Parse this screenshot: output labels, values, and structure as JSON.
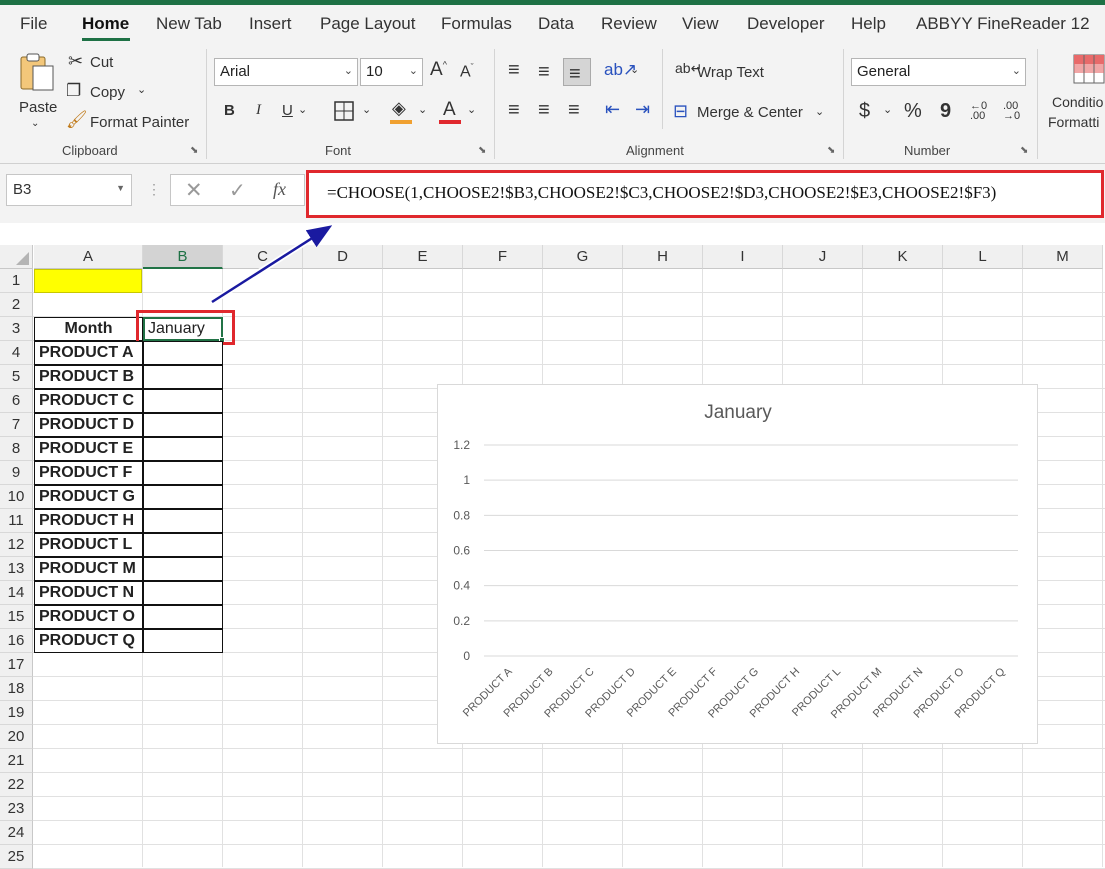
{
  "tabs": [
    "File",
    "Home",
    "New Tab",
    "Insert",
    "Page Layout",
    "Formulas",
    "Data",
    "Review",
    "View",
    "Developer",
    "Help",
    "ABBYY FineReader 12"
  ],
  "active_tab": "Home",
  "clipboard": {
    "paste": "Paste",
    "cut": "Cut",
    "copy": "Copy",
    "format_painter": "Format Painter",
    "label": "Clipboard"
  },
  "font": {
    "name": "Arial",
    "size": "10",
    "label": "Font",
    "bold": "B",
    "italic": "I",
    "underline": "U",
    "font_color": "#e0282d",
    "fill_color": "#f0a030"
  },
  "alignment": {
    "wrap": "Wrap Text",
    "merge": "Merge & Center",
    "label": "Alignment"
  },
  "number": {
    "format": "General",
    "label": "Number",
    "currency": "$",
    "percent": "%",
    "comma": "9"
  },
  "styles": {
    "conditional": "Conditio",
    "formatting": "Formatti"
  },
  "formula_bar": {
    "name_box": "B3",
    "fx": "fx",
    "formula": "=CHOOSE(1,CHOOSE2!$B3,CHOOSE2!$C3,CHOOSE2!$D3,CHOOSE2!$E3,CHOOSE2!$F3)"
  },
  "columns": [
    "A",
    "B",
    "C",
    "D",
    "E",
    "F",
    "G",
    "H",
    "I",
    "J",
    "K",
    "L",
    "M"
  ],
  "selected_column": "B",
  "rows": [
    "1",
    "2",
    "3",
    "4",
    "5",
    "6",
    "7",
    "8",
    "9",
    "10",
    "11",
    "12",
    "13",
    "14",
    "15",
    "16",
    "17",
    "18",
    "19",
    "20",
    "21",
    "22",
    "23",
    "24",
    "25"
  ],
  "cells": {
    "A3": "Month",
    "B3": "January"
  },
  "products": [
    "PRODUCT A",
    "PRODUCT B",
    "PRODUCT C",
    "PRODUCT D",
    "PRODUCT E",
    "PRODUCT F",
    "PRODUCT G",
    "PRODUCT H",
    "PRODUCT L",
    "PRODUCT M",
    "PRODUCT N",
    "PRODUCT O",
    "PRODUCT Q"
  ],
  "highlight_color": "#ffff00",
  "chart_data": {
    "type": "bar",
    "title": "January",
    "categories": [
      "PRODUCT A",
      "PRODUCT B",
      "PRODUCT C",
      "PRODUCT D",
      "PRODUCT E",
      "PRODUCT F",
      "PRODUCT G",
      "PRODUCT H",
      "PRODUCT L",
      "PRODUCT M",
      "PRODUCT N",
      "PRODUCT O",
      "PRODUCT Q"
    ],
    "values": [
      0,
      0,
      0,
      0,
      0,
      0,
      0,
      0,
      0,
      0,
      0,
      0,
      0
    ],
    "yticks": [
      "1.2",
      "1",
      "0.8",
      "0.6",
      "0.4",
      "0.2",
      "0"
    ],
    "ylim": [
      0,
      1.2
    ],
    "grid": true
  }
}
